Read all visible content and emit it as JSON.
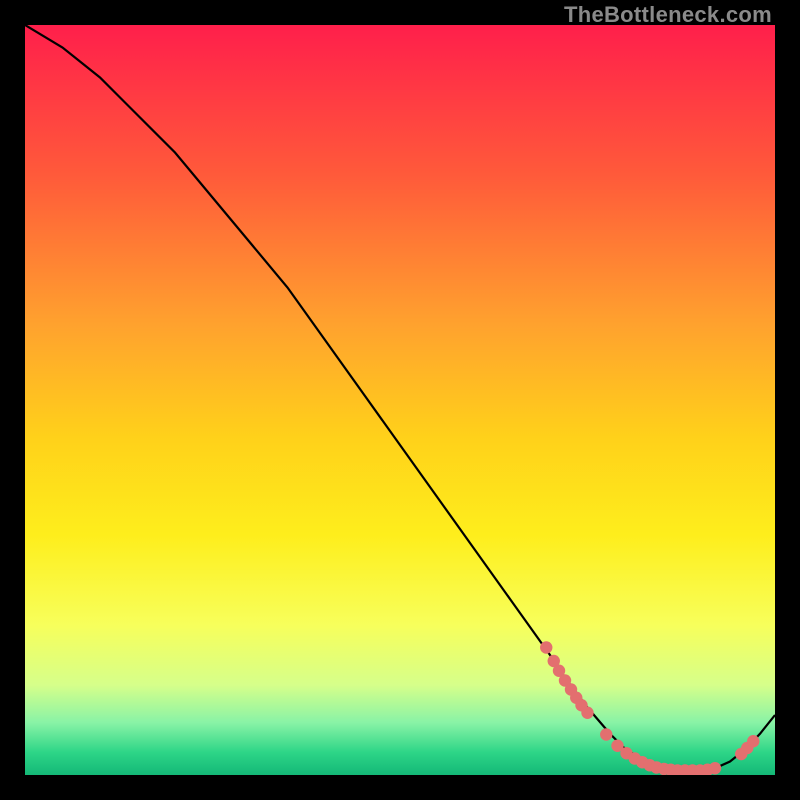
{
  "watermark": "TheBottleneck.com",
  "colors": {
    "curve_stroke": "#000000",
    "marker_fill": "#e36f6f",
    "gradient_stops": [
      {
        "offset": 0.0,
        "color": "#ff1f4b"
      },
      {
        "offset": 0.2,
        "color": "#ff5a3a"
      },
      {
        "offset": 0.4,
        "color": "#ffa22e"
      },
      {
        "offset": 0.55,
        "color": "#ffd11a"
      },
      {
        "offset": 0.68,
        "color": "#feee1c"
      },
      {
        "offset": 0.8,
        "color": "#f7ff5b"
      },
      {
        "offset": 0.88,
        "color": "#d6ff8a"
      },
      {
        "offset": 0.93,
        "color": "#89f3a6"
      },
      {
        "offset": 0.97,
        "color": "#2dd587"
      },
      {
        "offset": 1.0,
        "color": "#14b877"
      }
    ]
  },
  "chart_data": {
    "type": "line",
    "title": "",
    "xlabel": "",
    "ylabel": "",
    "xlim": [
      0,
      100
    ],
    "ylim": [
      0,
      100
    ],
    "series": [
      {
        "name": "curve",
        "x": [
          0,
          5,
          10,
          15,
          20,
          25,
          30,
          35,
          40,
          45,
          50,
          55,
          60,
          65,
          70,
          72,
          75,
          78,
          80,
          82,
          84,
          86,
          88,
          90,
          92,
          94,
          96,
          98,
          100
        ],
        "y": [
          100,
          97,
          93,
          88,
          83,
          77,
          71,
          65,
          58,
          51,
          44,
          37,
          30,
          23,
          16,
          13,
          9,
          5.5,
          3.5,
          2.3,
          1.5,
          1.0,
          0.7,
          0.6,
          0.9,
          1.8,
          3.4,
          5.5,
          8.0
        ]
      }
    ],
    "marker_groups": [
      {
        "name": "left-cluster",
        "points": [
          {
            "x": 69.5,
            "y": 17.0
          },
          {
            "x": 70.5,
            "y": 15.2
          },
          {
            "x": 71.2,
            "y": 13.9
          },
          {
            "x": 72.0,
            "y": 12.6
          },
          {
            "x": 72.8,
            "y": 11.4
          },
          {
            "x": 73.5,
            "y": 10.3
          },
          {
            "x": 74.2,
            "y": 9.3
          },
          {
            "x": 75.0,
            "y": 8.3
          }
        ]
      },
      {
        "name": "bottom-cluster",
        "points": [
          {
            "x": 77.5,
            "y": 5.4
          },
          {
            "x": 79.0,
            "y": 3.9
          },
          {
            "x": 80.2,
            "y": 2.9
          },
          {
            "x": 81.3,
            "y": 2.2
          },
          {
            "x": 82.3,
            "y": 1.7
          },
          {
            "x": 83.3,
            "y": 1.3
          },
          {
            "x": 84.2,
            "y": 1.0
          },
          {
            "x": 85.2,
            "y": 0.8
          },
          {
            "x": 86.1,
            "y": 0.7
          },
          {
            "x": 87.0,
            "y": 0.6
          },
          {
            "x": 88.0,
            "y": 0.6
          },
          {
            "x": 89.0,
            "y": 0.6
          },
          {
            "x": 90.0,
            "y": 0.6
          },
          {
            "x": 91.0,
            "y": 0.7
          },
          {
            "x": 92.0,
            "y": 0.9
          }
        ]
      },
      {
        "name": "right-cluster",
        "points": [
          {
            "x": 95.5,
            "y": 2.8
          },
          {
            "x": 96.3,
            "y": 3.6
          },
          {
            "x": 97.1,
            "y": 4.5
          }
        ]
      }
    ]
  }
}
